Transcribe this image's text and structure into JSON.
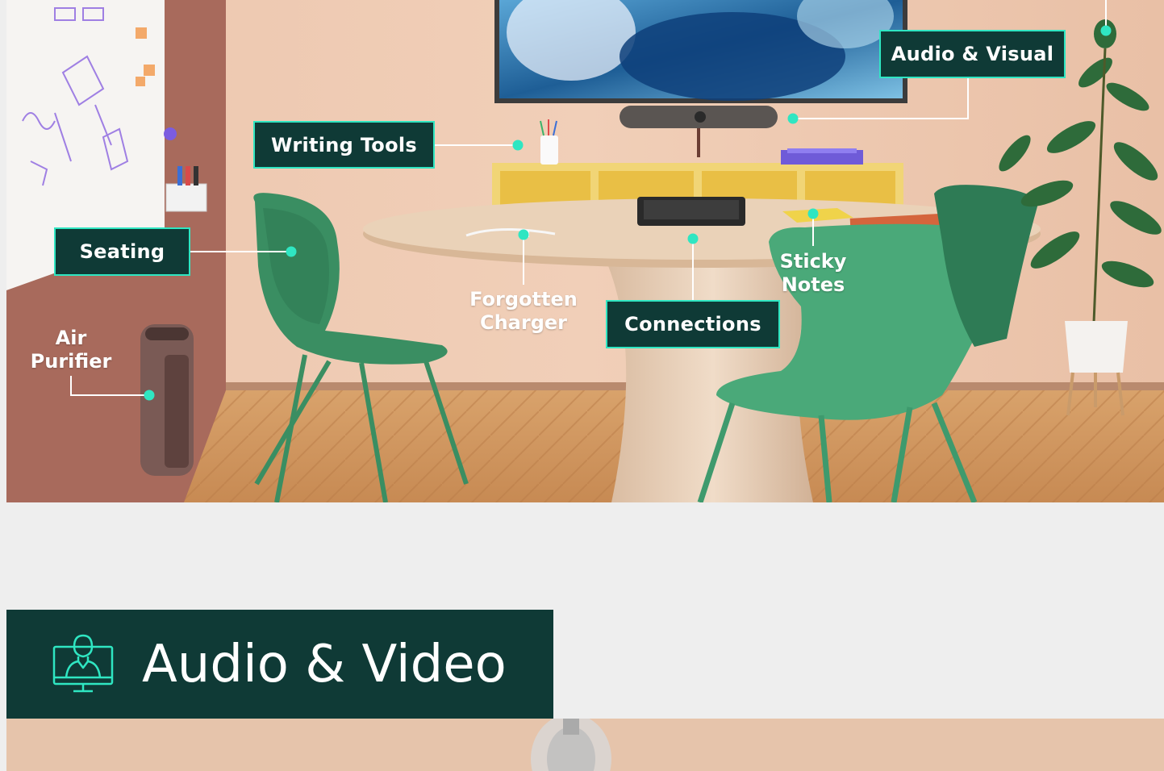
{
  "hotspots": {
    "audio_visual": "Audio & Visual",
    "writing_tools": "Writing Tools",
    "seating": "Seating",
    "forgotten_charger": "Forgotten\nCharger",
    "connections": "Connections",
    "sticky_notes": "Sticky\nNotes",
    "air_purifier": "Air\nPurifier"
  },
  "section": {
    "title": "Audio & Video",
    "icon": "presenter-monitor-icon"
  },
  "colors": {
    "brand_dark": "#0f3a36",
    "accent": "#2fe6c2",
    "page_bg": "#eeeeee"
  }
}
